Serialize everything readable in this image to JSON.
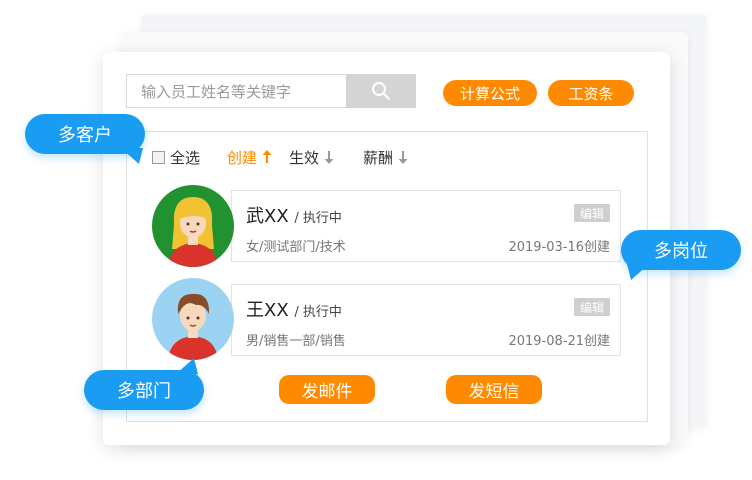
{
  "search": {
    "placeholder": "输入员工姓名等关键字"
  },
  "toolbar": {
    "formula_label": "计算公式",
    "payslip_label": "工资条"
  },
  "filters": {
    "select_all": "全选",
    "create": "创建",
    "effective": "生效",
    "salary": "薪酬"
  },
  "employees": [
    {
      "name": "武XX",
      "status": "/ 执行中",
      "details": "女/测试部门/技术",
      "created": "2019-03-16创建",
      "edit_label": "编辑"
    },
    {
      "name": "王XX",
      "status": "/ 执行中",
      "details": "男/销售一部/销售",
      "created": "2019-08-21创建",
      "edit_label": "编辑"
    }
  ],
  "actions": {
    "email_label": "发邮件",
    "sms_label": "发短信"
  },
  "callouts": {
    "multi_customer": "多客户",
    "multi_position": "多岗位",
    "multi_department": "多部门"
  },
  "colors": {
    "accent": "#ff8a00",
    "callout": "#1a9cf2",
    "edit_badge": "#cfcfcf"
  },
  "icons": {
    "search": "magnifier-icon",
    "sort_up": "arrow-up-icon",
    "sort_down": "arrow-down-icon"
  }
}
